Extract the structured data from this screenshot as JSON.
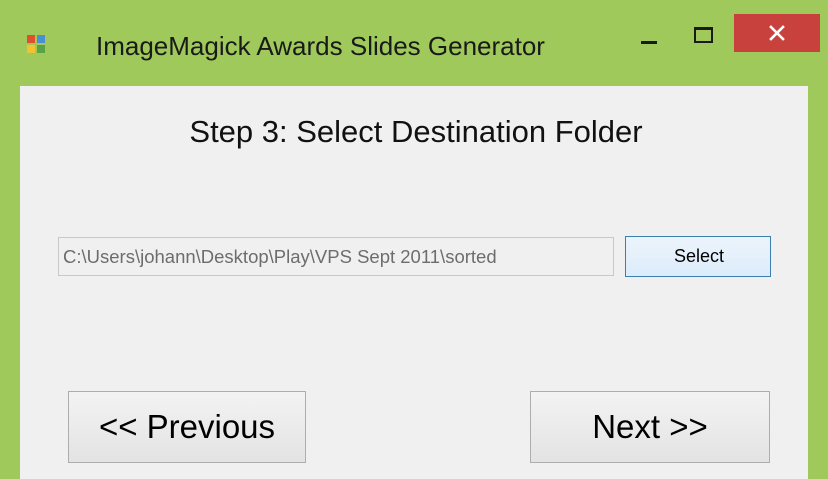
{
  "window": {
    "title": "ImageMagick Awards Slides Generator",
    "colors": {
      "frame": "#9fc95a",
      "close": "#c9413c",
      "client": "#f0f0f0",
      "select_border": "#3c7fb1"
    }
  },
  "step": {
    "title": "Step 3:  Select Destination Folder"
  },
  "destination": {
    "path_value": "C:\\Users\\johann\\Desktop\\Play\\VPS Sept 2011\\sorted",
    "select_label": "Select"
  },
  "navigation": {
    "previous_label": "<< Previous",
    "next_label": "Next >>"
  }
}
